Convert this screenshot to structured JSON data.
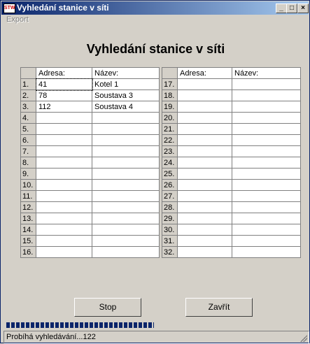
{
  "window": {
    "title": "Vyhledání stanice v síti",
    "icon": "app-icon",
    "icon_text": "STW"
  },
  "titlebar_buttons": {
    "minimize": "_",
    "maximize": "□",
    "close": "×"
  },
  "menu": {
    "export": "Export"
  },
  "heading": "Vyhledání stanice v síti",
  "table_left": {
    "headers": {
      "address": "Adresa:",
      "name": "Název:"
    },
    "rows": [
      {
        "num": "1.",
        "address": "41",
        "name": "Kotel 1"
      },
      {
        "num": "2.",
        "address": "78",
        "name": "Soustava 3"
      },
      {
        "num": "3.",
        "address": "112",
        "name": "Soustava 4"
      },
      {
        "num": "4.",
        "address": "",
        "name": ""
      },
      {
        "num": "5.",
        "address": "",
        "name": ""
      },
      {
        "num": "6.",
        "address": "",
        "name": ""
      },
      {
        "num": "7.",
        "address": "",
        "name": ""
      },
      {
        "num": "8.",
        "address": "",
        "name": ""
      },
      {
        "num": "9.",
        "address": "",
        "name": ""
      },
      {
        "num": "10.",
        "address": "",
        "name": ""
      },
      {
        "num": "11.",
        "address": "",
        "name": ""
      },
      {
        "num": "12.",
        "address": "",
        "name": ""
      },
      {
        "num": "13.",
        "address": "",
        "name": ""
      },
      {
        "num": "14.",
        "address": "",
        "name": ""
      },
      {
        "num": "15.",
        "address": "",
        "name": ""
      },
      {
        "num": "16.",
        "address": "",
        "name": ""
      }
    ]
  },
  "table_right": {
    "headers": {
      "address": "Adresa:",
      "name": "Název:"
    },
    "rows": [
      {
        "num": "17.",
        "address": "",
        "name": ""
      },
      {
        "num": "18.",
        "address": "",
        "name": ""
      },
      {
        "num": "19.",
        "address": "",
        "name": ""
      },
      {
        "num": "20.",
        "address": "",
        "name": ""
      },
      {
        "num": "21.",
        "address": "",
        "name": ""
      },
      {
        "num": "22.",
        "address": "",
        "name": ""
      },
      {
        "num": "23.",
        "address": "",
        "name": ""
      },
      {
        "num": "24.",
        "address": "",
        "name": ""
      },
      {
        "num": "25.",
        "address": "",
        "name": ""
      },
      {
        "num": "26.",
        "address": "",
        "name": ""
      },
      {
        "num": "27.",
        "address": "",
        "name": ""
      },
      {
        "num": "28.",
        "address": "",
        "name": ""
      },
      {
        "num": "29.",
        "address": "",
        "name": ""
      },
      {
        "num": "30.",
        "address": "",
        "name": ""
      },
      {
        "num": "31.",
        "address": "",
        "name": ""
      },
      {
        "num": "32.",
        "address": "",
        "name": ""
      }
    ]
  },
  "buttons": {
    "stop": "Stop",
    "close": "Zavřít"
  },
  "progress": {
    "fraction": 0.49
  },
  "status": {
    "text": "Probíhá vyhledávání...122"
  }
}
